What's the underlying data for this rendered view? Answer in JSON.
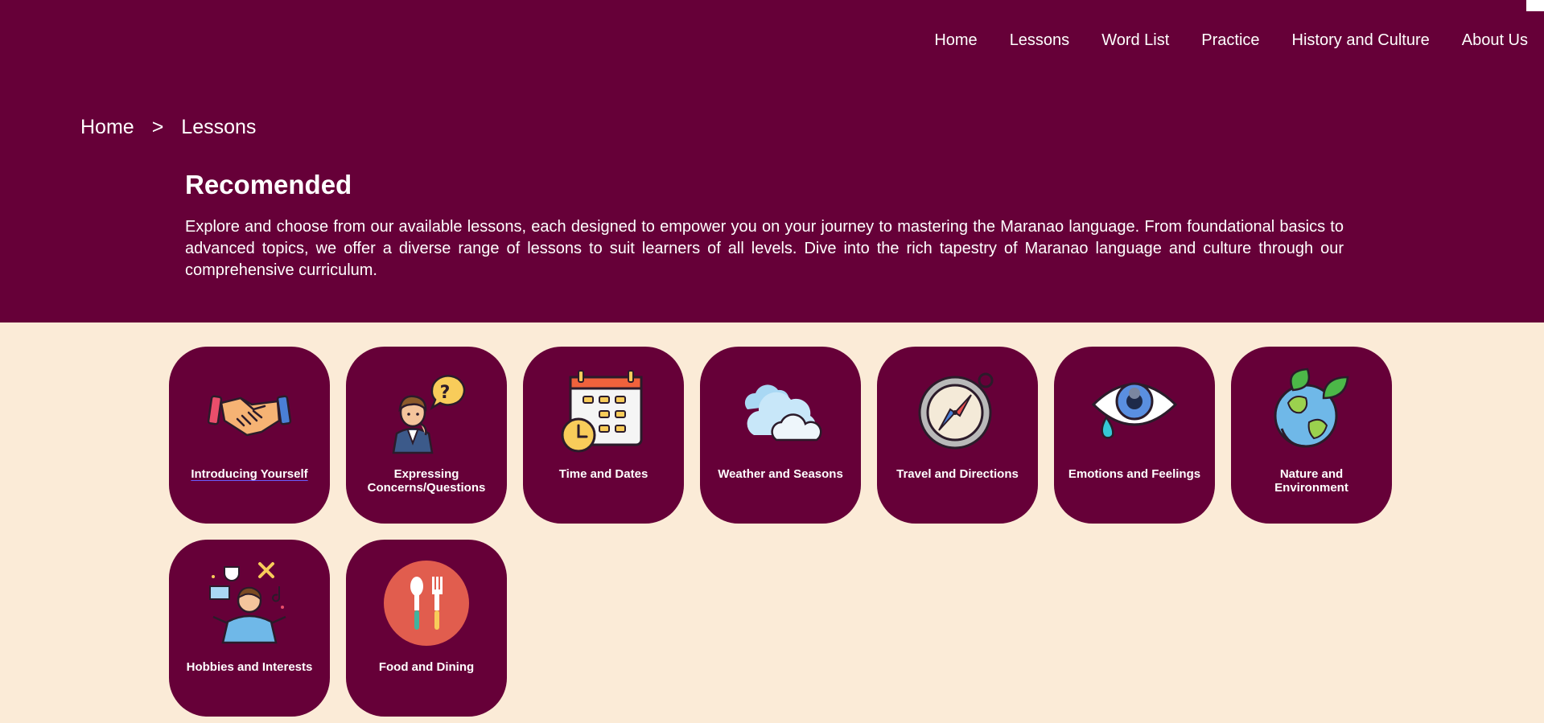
{
  "nav": {
    "items": [
      {
        "label": "Home"
      },
      {
        "label": "Lessons"
      },
      {
        "label": "Word List"
      },
      {
        "label": "Practice"
      },
      {
        "label": "History and Culture"
      },
      {
        "label": "About Us"
      }
    ]
  },
  "breadcrumb": {
    "home": "Home",
    "separator": ">",
    "current": "Lessons"
  },
  "hero": {
    "title": "Recomended",
    "description": "Explore and choose from our available lessons, each designed to empower you on your journey to mastering the Maranao language. From foundational basics to advanced topics, we offer a diverse range of lessons to suit learners of all levels. Dive into the rich tapestry of Maranao language and culture through our comprehensive curriculum."
  },
  "lessons": [
    {
      "label": "Introducing Yourself",
      "icon": "handshake-icon"
    },
    {
      "label": "Expressing Concerns/Questions",
      "icon": "person-question-icon"
    },
    {
      "label": "Time and Dates",
      "icon": "calendar-clock-icon"
    },
    {
      "label": "Weather and Seasons",
      "icon": "clouds-icon"
    },
    {
      "label": "Travel and Directions",
      "icon": "compass-icon"
    },
    {
      "label": "Emotions and Feelings",
      "icon": "crying-eye-icon"
    },
    {
      "label": "Nature and Environment",
      "icon": "earth-leaves-icon"
    },
    {
      "label": "Hobbies and Interests",
      "icon": "person-hobbies-icon"
    },
    {
      "label": "Food and Dining",
      "icon": "spoon-fork-icon"
    }
  ],
  "colors": {
    "primary": "#660038",
    "background": "#fbebd7",
    "text_light": "#ffffff"
  }
}
